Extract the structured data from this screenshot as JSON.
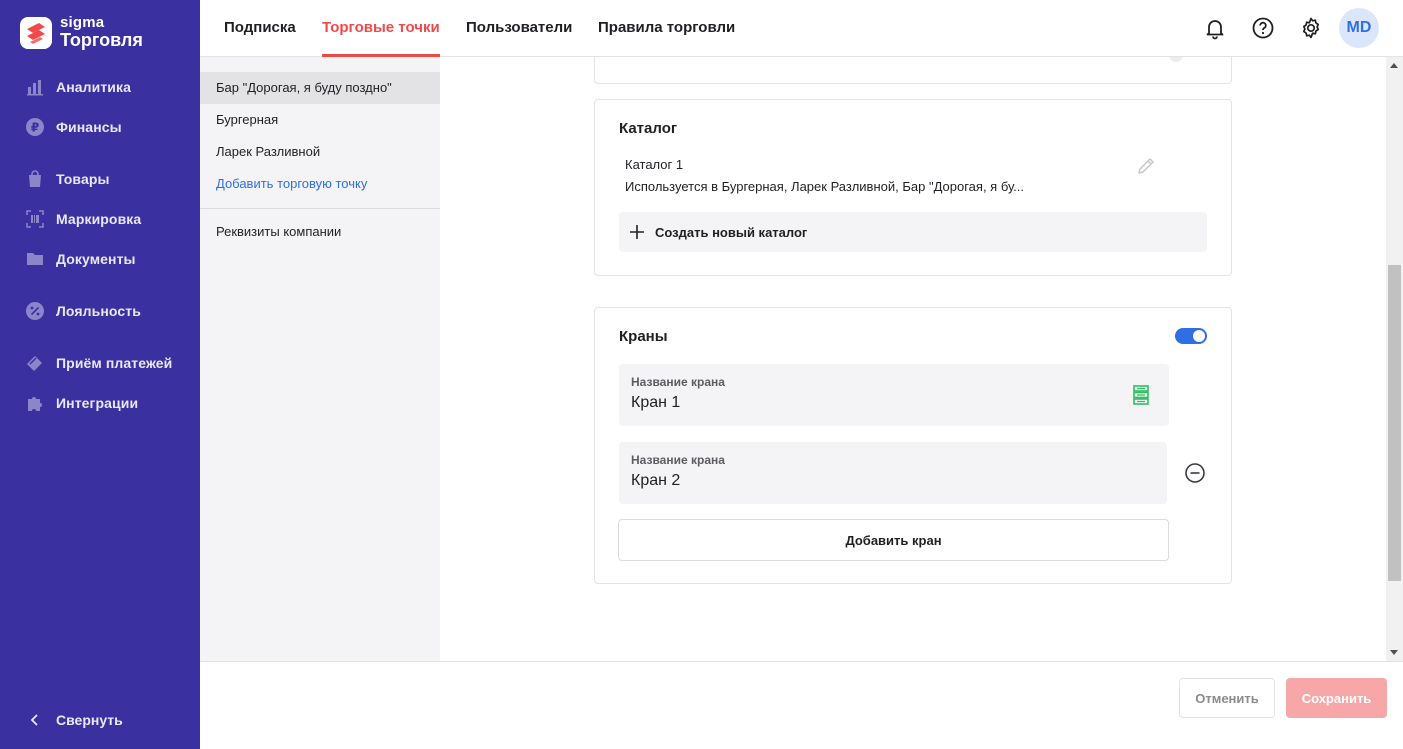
{
  "app": {
    "logo_small": "sigma",
    "logo_big": "Торговля"
  },
  "sidebar": {
    "items": [
      {
        "label": "Аналитика",
        "icon": "bar-chart-icon"
      },
      {
        "label": "Финансы",
        "icon": "ruble-icon"
      },
      {
        "label": "Товары",
        "icon": "shopping-bag-icon"
      },
      {
        "label": "Маркировка",
        "icon": "barcode-icon"
      },
      {
        "label": "Документы",
        "icon": "folder-icon"
      },
      {
        "label": "Лояльность",
        "icon": "discount-icon"
      },
      {
        "label": "Приём платежей",
        "icon": "card-icon"
      },
      {
        "label": "Интеграции",
        "icon": "puzzle-icon"
      }
    ],
    "collapse_label": "Свернуть"
  },
  "header": {
    "tabs": [
      {
        "label": "Подписка"
      },
      {
        "label": "Торговые точки"
      },
      {
        "label": "Пользователи"
      },
      {
        "label": "Правила торговли"
      }
    ],
    "active_tab": "Торговые точки",
    "avatar": "MD"
  },
  "subpanel": {
    "items": [
      {
        "label": "Бар \"Дорогая, я буду поздно\""
      },
      {
        "label": "Бургерная"
      },
      {
        "label": "Ларек Разливной"
      }
    ],
    "add_link": "Добавить торговую точку",
    "company": "Реквизиты компании"
  },
  "catalog": {
    "title": "Каталог",
    "name": "Каталог 1",
    "usage": "Используется в Бургерная, Ларек Разливной, Бар \"Дорогая, я бу...",
    "create_label": "Создать новый каталог"
  },
  "taps": {
    "title": "Краны",
    "enabled": true,
    "field_label": "Название крана",
    "items": [
      {
        "value": "Кран 1"
      },
      {
        "value": "Кран 2"
      }
    ],
    "add_label": "Добавить кран"
  },
  "footer": {
    "cancel_label": "Отменить",
    "save_label": "Сохранить"
  },
  "colors": {
    "sidebar": "#3a30a0",
    "accent": "#ef4a4a",
    "link": "#2f6fe4",
    "save_disabled": "#f7a7a7"
  }
}
